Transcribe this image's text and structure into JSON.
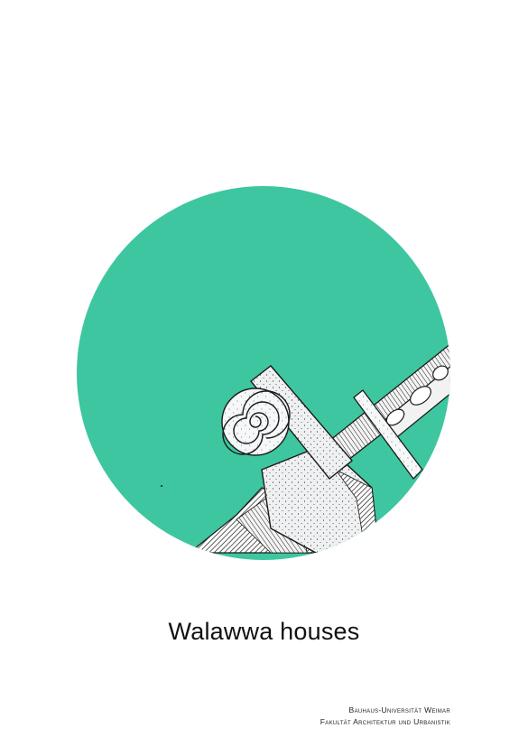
{
  "poster": {
    "title": "Walawwa houses",
    "institution_line1": "Bauhaus-Universität Weimar",
    "institution_line2": "Fakultät Architektur und Urbanistik"
  },
  "colors": {
    "circle": "#3ec6a0",
    "ink": "#1a1a1a",
    "paper": "#eef0f2",
    "background": "#ffffff"
  },
  "icons": {
    "illustration": "architectural-detail-sketch"
  }
}
